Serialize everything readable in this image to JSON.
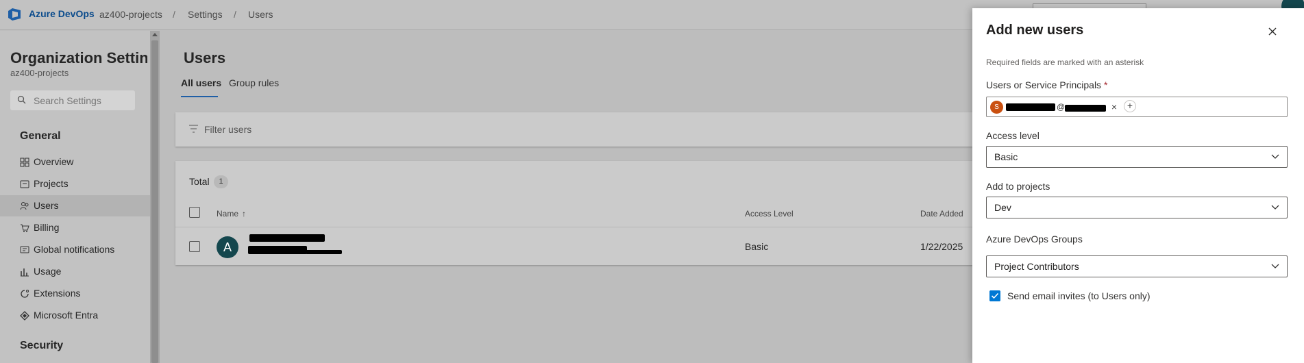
{
  "header": {
    "brand": "Azure DevOps",
    "breadcrumbs": [
      "az400-projects",
      "Settings",
      "Users"
    ],
    "separator": "/"
  },
  "sidebar": {
    "title": "Organization Settin...",
    "subtitle": "az400-projects",
    "search_placeholder": "Search Settings",
    "sections": [
      {
        "title": "General",
        "items": [
          {
            "label": "Overview",
            "icon": "grid-icon"
          },
          {
            "label": "Projects",
            "icon": "projects-icon"
          },
          {
            "label": "Users",
            "icon": "users-icon",
            "active": true
          },
          {
            "label": "Billing",
            "icon": "cart-icon"
          },
          {
            "label": "Global notifications",
            "icon": "notification-icon"
          },
          {
            "label": "Usage",
            "icon": "chart-icon"
          },
          {
            "label": "Extensions",
            "icon": "extension-icon"
          },
          {
            "label": "Microsoft Entra",
            "icon": "entra-icon"
          }
        ]
      },
      {
        "title": "Security"
      }
    ]
  },
  "main": {
    "title": "Users",
    "tabs": [
      {
        "label": "All users",
        "selected": true
      },
      {
        "label": "Group rules",
        "selected": false
      }
    ],
    "filter_placeholder": "Filter users",
    "table": {
      "total_label": "Total",
      "total_count": "1",
      "columns": [
        "Name",
        "Access Level",
        "Date Added"
      ],
      "sort_indicator": "↑",
      "rows": [
        {
          "avatar_letter": "A",
          "access_level": "Basic",
          "date_added": "1/22/2025"
        }
      ]
    }
  },
  "dialog": {
    "title": "Add new users",
    "required_note": "Required fields are marked with an asterisk",
    "principals_label": "Users or Service Principals",
    "required_marker": "*",
    "principal_chip_avatar": "S",
    "principal_chip_email_at": "@",
    "access_level_label": "Access level",
    "access_level_value": "Basic",
    "projects_label": "Add to projects",
    "projects_value": "Dev",
    "groups_label": "Azure DevOps Groups",
    "groups_value": "Project Contributors",
    "send_invites_label": "Send email invites (to Users only)",
    "send_invites_checked": true
  },
  "colors": {
    "accent": "#0078d4",
    "brand": "#0a4b8c",
    "avatar_teal": "#14474e",
    "chip_orange": "#ca5010"
  }
}
